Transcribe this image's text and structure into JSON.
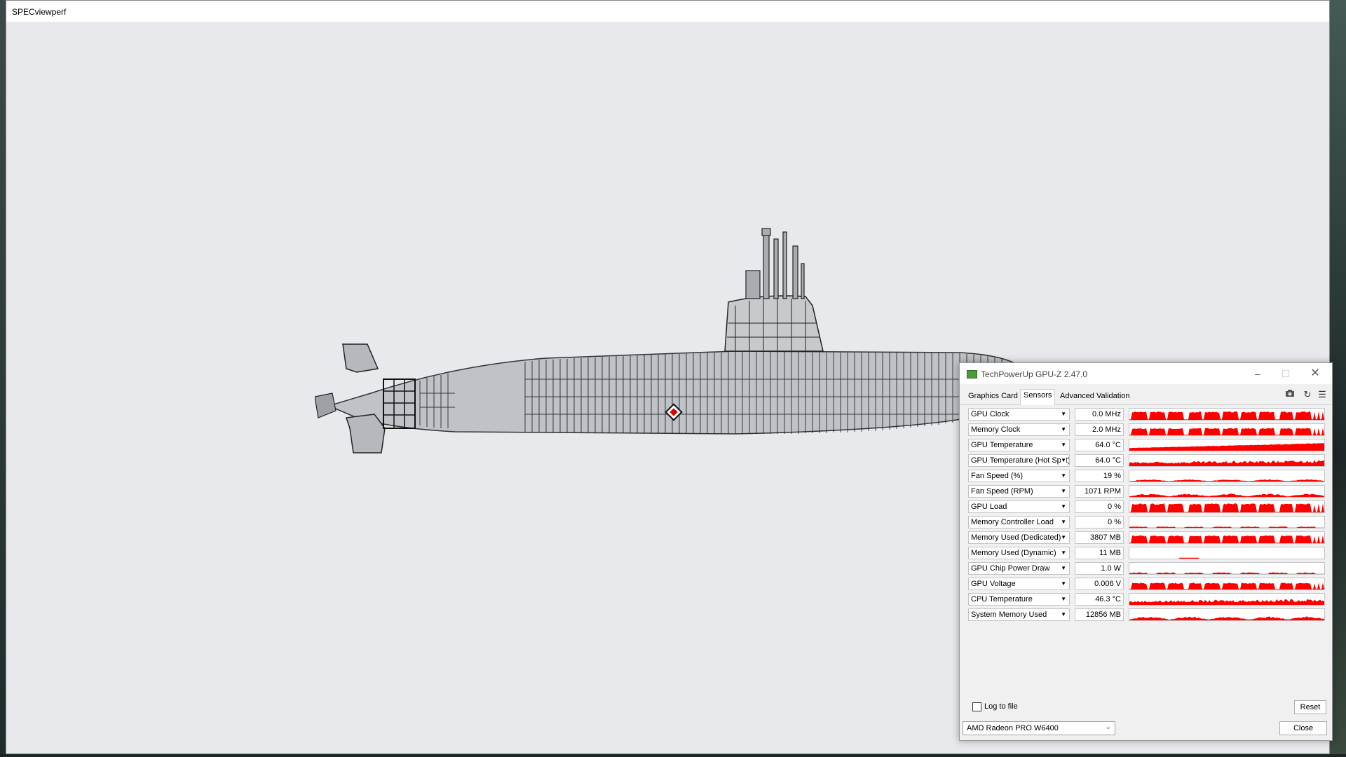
{
  "desktop": {},
  "viewer": {
    "title": "SPECviewperf"
  },
  "gpuz": {
    "title": "TechPowerUp GPU-Z 2.47.0",
    "window_buttons": {
      "minimize": "–",
      "maximize": "☐",
      "close": "✕"
    },
    "tabs": [
      {
        "label": "Graphics Card",
        "active": false
      },
      {
        "label": "Sensors",
        "active": true
      },
      {
        "label": "Advanced",
        "active": false
      },
      {
        "label": "Validation",
        "active": false
      }
    ],
    "toolbar_icons": [
      "camera-icon",
      "refresh-icon",
      "menu-icon"
    ],
    "sensor_color": "#ff0000",
    "sensors": [
      {
        "name": "GPU Clock",
        "value": "0.0 MHz",
        "pattern": "bursty",
        "level": 0.75
      },
      {
        "name": "Memory Clock",
        "value": "2.0 MHz",
        "pattern": "bursty",
        "level": 0.65
      },
      {
        "name": "GPU Temperature",
        "value": "64.0 °C",
        "pattern": "rising",
        "level": 0.7
      },
      {
        "name": "GPU Temperature (Hot Spot)",
        "value": "64.0 °C",
        "pattern": "noisy",
        "level": 0.55
      },
      {
        "name": "Fan Speed (%)",
        "value": "19 %",
        "pattern": "low",
        "level": 0.2
      },
      {
        "name": "Fan Speed (RPM)",
        "value": "1071 RPM",
        "pattern": "low",
        "level": 0.3
      },
      {
        "name": "GPU Load",
        "value": "0 %",
        "pattern": "bursty",
        "level": 0.8
      },
      {
        "name": "Memory Controller Load",
        "value": "0 %",
        "pattern": "sparse",
        "level": 0.12
      },
      {
        "name": "Memory Used (Dedicated)",
        "value": "3807 MB",
        "pattern": "bursty",
        "level": 0.7
      },
      {
        "name": "Memory Used (Dynamic)",
        "value": "11 MB",
        "pattern": "flat",
        "level": 0.05
      },
      {
        "name": "GPU Chip Power Draw",
        "value": "1.0 W",
        "pattern": "sparse",
        "level": 0.15
      },
      {
        "name": "GPU Voltage",
        "value": "0.006 V",
        "pattern": "bursty",
        "level": 0.6
      },
      {
        "name": "CPU Temperature",
        "value": "46.3 °C",
        "pattern": "noisy",
        "level": 0.55
      },
      {
        "name": "System Memory Used",
        "value": "12856 MB",
        "pattern": "low",
        "level": 0.35
      }
    ],
    "log_to_file": {
      "label": "Log to file",
      "checked": false
    },
    "reset_label": "Reset",
    "gpu_select": {
      "value": "AMD Radeon PRO W6400"
    },
    "close_label": "Close"
  }
}
